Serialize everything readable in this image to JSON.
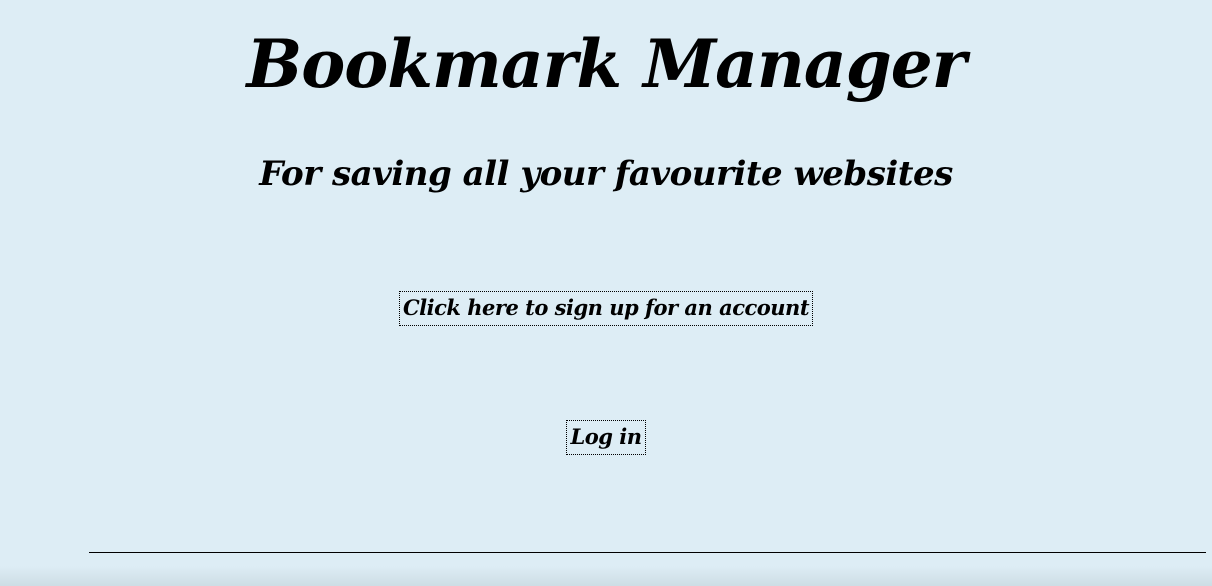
{
  "header": {
    "title": "Bookmark Manager",
    "subtitle": "For saving all your favourite websites"
  },
  "actions": {
    "signup_label": "Click here to sign up for an account",
    "login_label": "Log in"
  },
  "colors": {
    "background": "#ddedf5",
    "text": "#000000"
  }
}
